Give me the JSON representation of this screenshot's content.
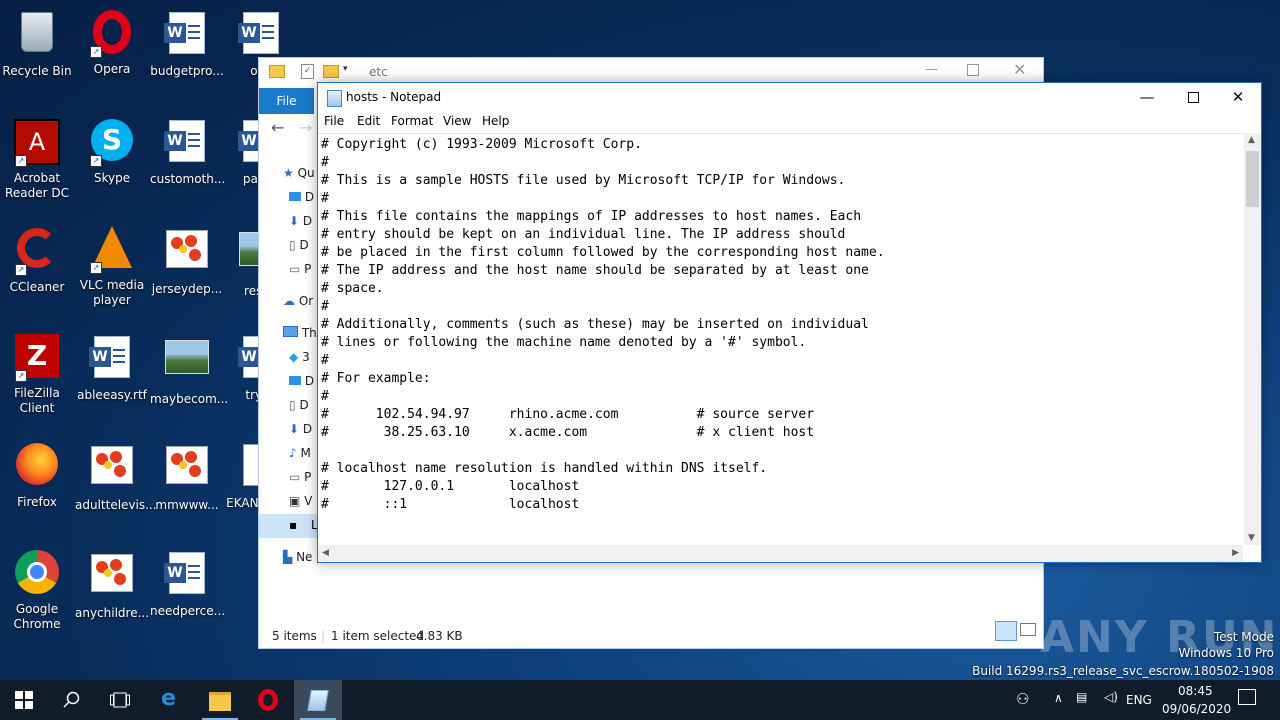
{
  "desktop": {
    "icons": [
      {
        "label": "Recycle Bin"
      },
      {
        "label": "Opera"
      },
      {
        "label": "budgetpro..."
      },
      {
        "label": "ofci"
      },
      {
        "label": "Acrobat Reader DC"
      },
      {
        "label": "Skype"
      },
      {
        "label": "customoth..."
      },
      {
        "label": "pages"
      },
      {
        "label": "CCleaner"
      },
      {
        "label": "VLC media player"
      },
      {
        "label": "jerseydep..."
      },
      {
        "label": "result"
      },
      {
        "label": "FileZilla Client"
      },
      {
        "label": "ableeasy.rtf"
      },
      {
        "label": "maybecom..."
      },
      {
        "label": "tryve"
      },
      {
        "label": "Firefox"
      },
      {
        "label": "adulttelevis..."
      },
      {
        "label": "mmwww..."
      },
      {
        "label": "EKAN ranso"
      },
      {
        "label": "Google Chrome"
      },
      {
        "label": "anychildre..."
      },
      {
        "label": "needperce..."
      }
    ]
  },
  "explorer": {
    "path": "etc",
    "file_tab": "File",
    "nav": [
      "Qu",
      "D",
      "D",
      "D",
      "P",
      "Or",
      "Th",
      "3",
      "D",
      "D",
      "D",
      "M",
      "P",
      "V",
      "L",
      "Ne"
    ],
    "status_items": "5 items",
    "status_selected": "1 item selected",
    "status_size": "4.83 KB"
  },
  "notepad": {
    "title": "hosts - Notepad",
    "menu": [
      "File",
      "Edit",
      "Format",
      "View",
      "Help"
    ],
    "content": "# Copyright (c) 1993-2009 Microsoft Corp.\n#\n# This is a sample HOSTS file used by Microsoft TCP/IP for Windows.\n#\n# This file contains the mappings of IP addresses to host names. Each\n# entry should be kept on an individual line. The IP address should\n# be placed in the first column followed by the corresponding host name.\n# The IP address and the host name should be separated by at least one\n# space.\n#\n# Additionally, comments (such as these) may be inserted on individual\n# lines or following the machine name denoted by a '#' symbol.\n#\n# For example:\n#\n#      102.54.94.97     rhino.acme.com          # source server\n#       38.25.63.10     x.acme.com              # x client host\n\n# localhost name resolution is handled within DNS itself.\n#\t127.0.0.1       localhost\n#\t::1             localhost"
  },
  "watermark": {
    "brand": "ANY RUN",
    "line1": "Test Mode",
    "line2": "Windows 10 Pro",
    "line3": "Build 16299.rs3_release_svc_escrow.180502-1908"
  },
  "taskbar": {
    "language": "ENG",
    "time": "08:45",
    "date": "09/06/2020"
  }
}
